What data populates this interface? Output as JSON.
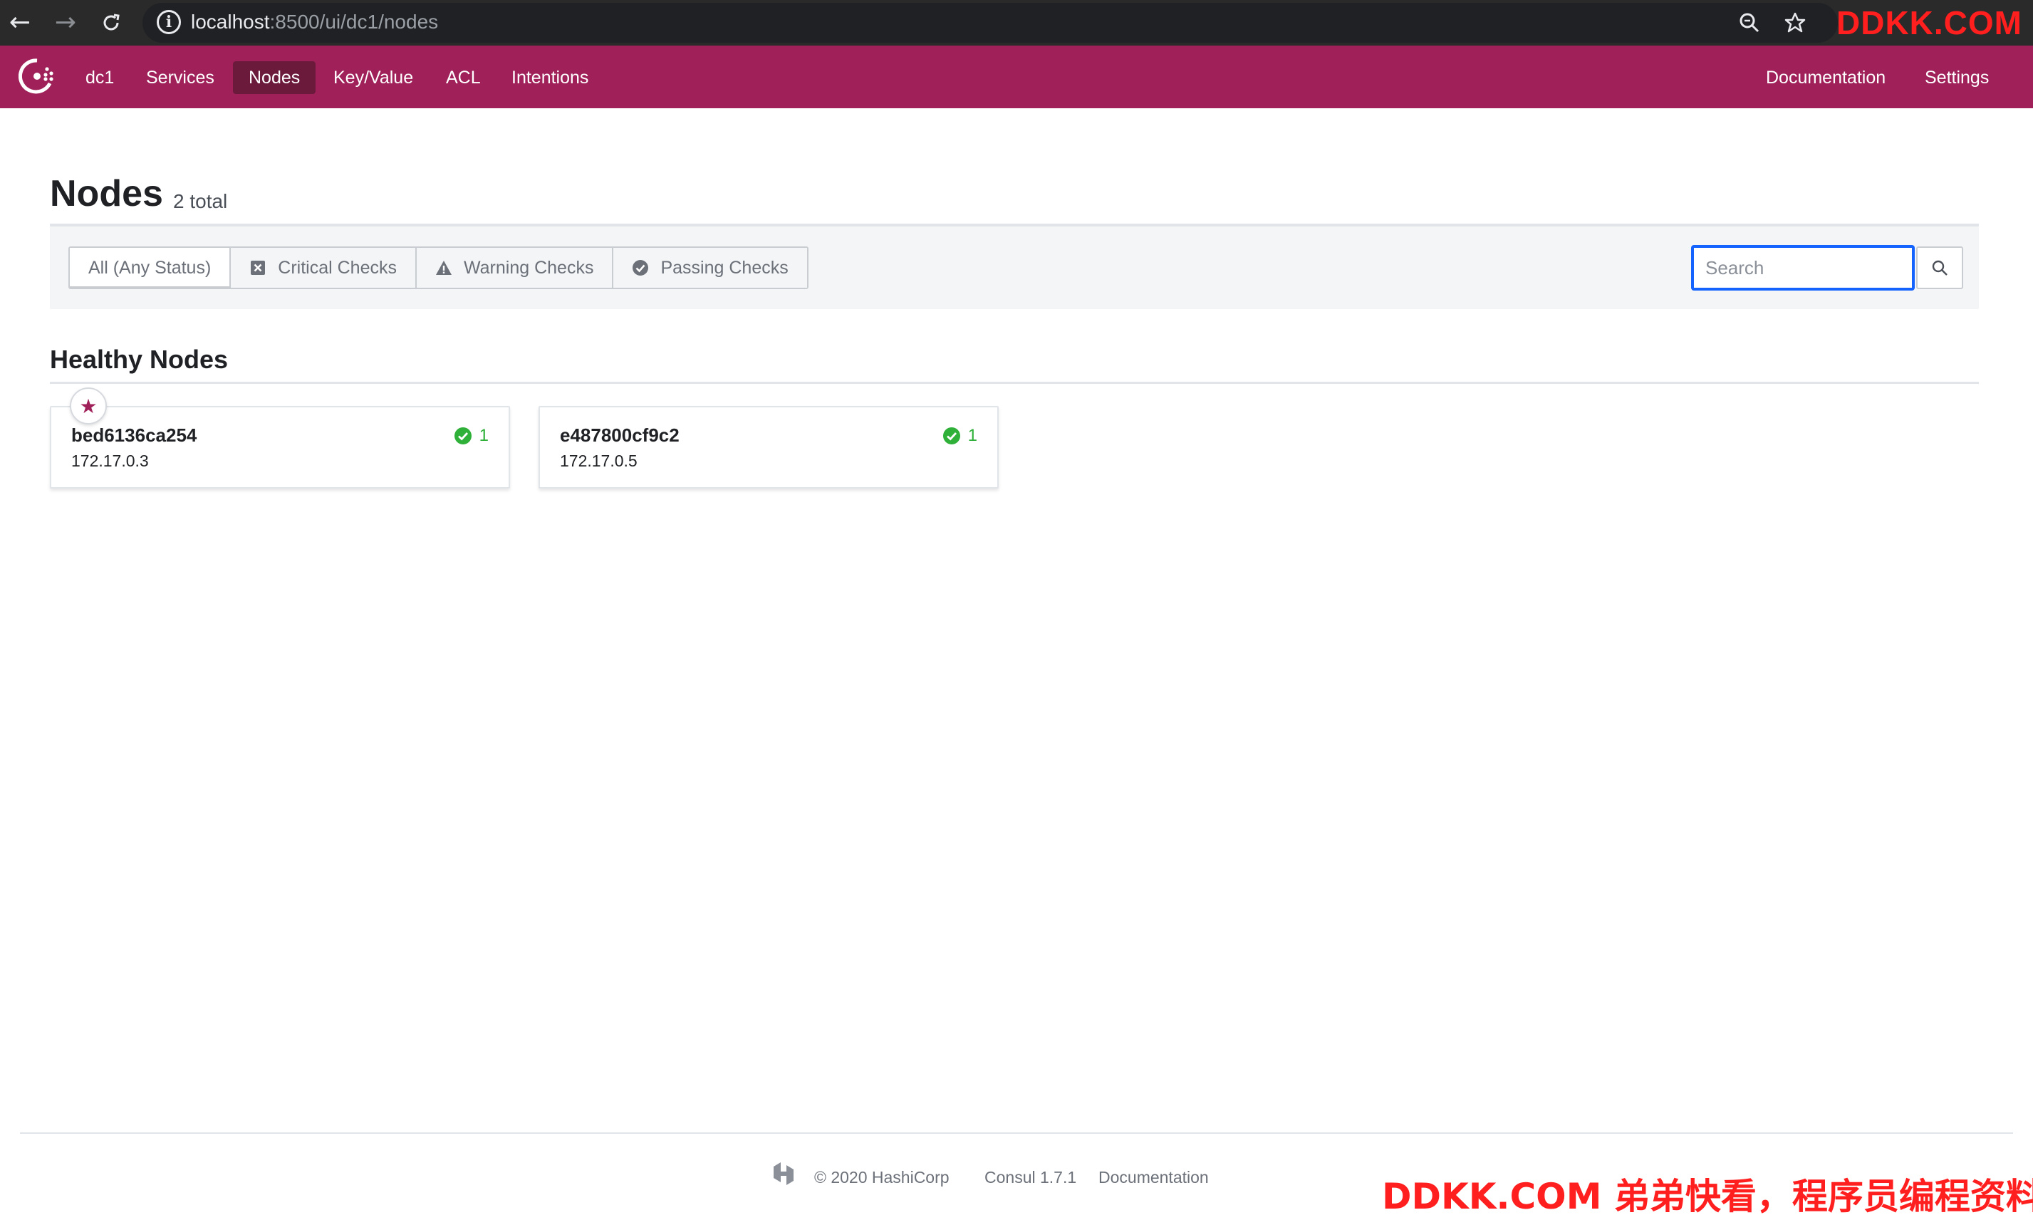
{
  "browser": {
    "url_host": "localhost",
    "url_rest": ":8500/ui/dc1/nodes",
    "watermark": "DDKK.COM"
  },
  "nav": {
    "datacenter": "dc1",
    "items": [
      {
        "label": "Services"
      },
      {
        "label": "Nodes"
      },
      {
        "label": "Key/Value"
      },
      {
        "label": "ACL"
      },
      {
        "label": "Intentions"
      }
    ],
    "active": "Nodes",
    "right_items": [
      {
        "label": "Documentation"
      },
      {
        "label": "Settings"
      }
    ],
    "accent_color": "#a0215a"
  },
  "page": {
    "title": "Nodes",
    "count": "2 total"
  },
  "filters": {
    "options": [
      {
        "label": "All (Any Status)",
        "icon": "none"
      },
      {
        "label": "Critical Checks",
        "icon": "critical-icon"
      },
      {
        "label": "Warning Checks",
        "icon": "warning-icon"
      },
      {
        "label": "Passing Checks",
        "icon": "passing-icon"
      }
    ],
    "selected": "All (Any Status)"
  },
  "search": {
    "placeholder": "Search",
    "value": ""
  },
  "sections": {
    "healthy_title": "Healthy Nodes"
  },
  "nodes": [
    {
      "name": "bed6136ca254",
      "address": "172.17.0.3",
      "passing": "1",
      "leader": true
    },
    {
      "name": "e487800cf9c2",
      "address": "172.17.0.5",
      "passing": "1",
      "leader": false
    }
  ],
  "footer": {
    "copyright": "© 2020 HashiCorp",
    "version": "Consul 1.7.1",
    "docs": "Documentation"
  },
  "watermark_bottom": "DDKK.COM 弟弟快看，程序员编程资料站",
  "colors": {
    "passing": "#2eb039",
    "search_focus": "#1563ff"
  }
}
